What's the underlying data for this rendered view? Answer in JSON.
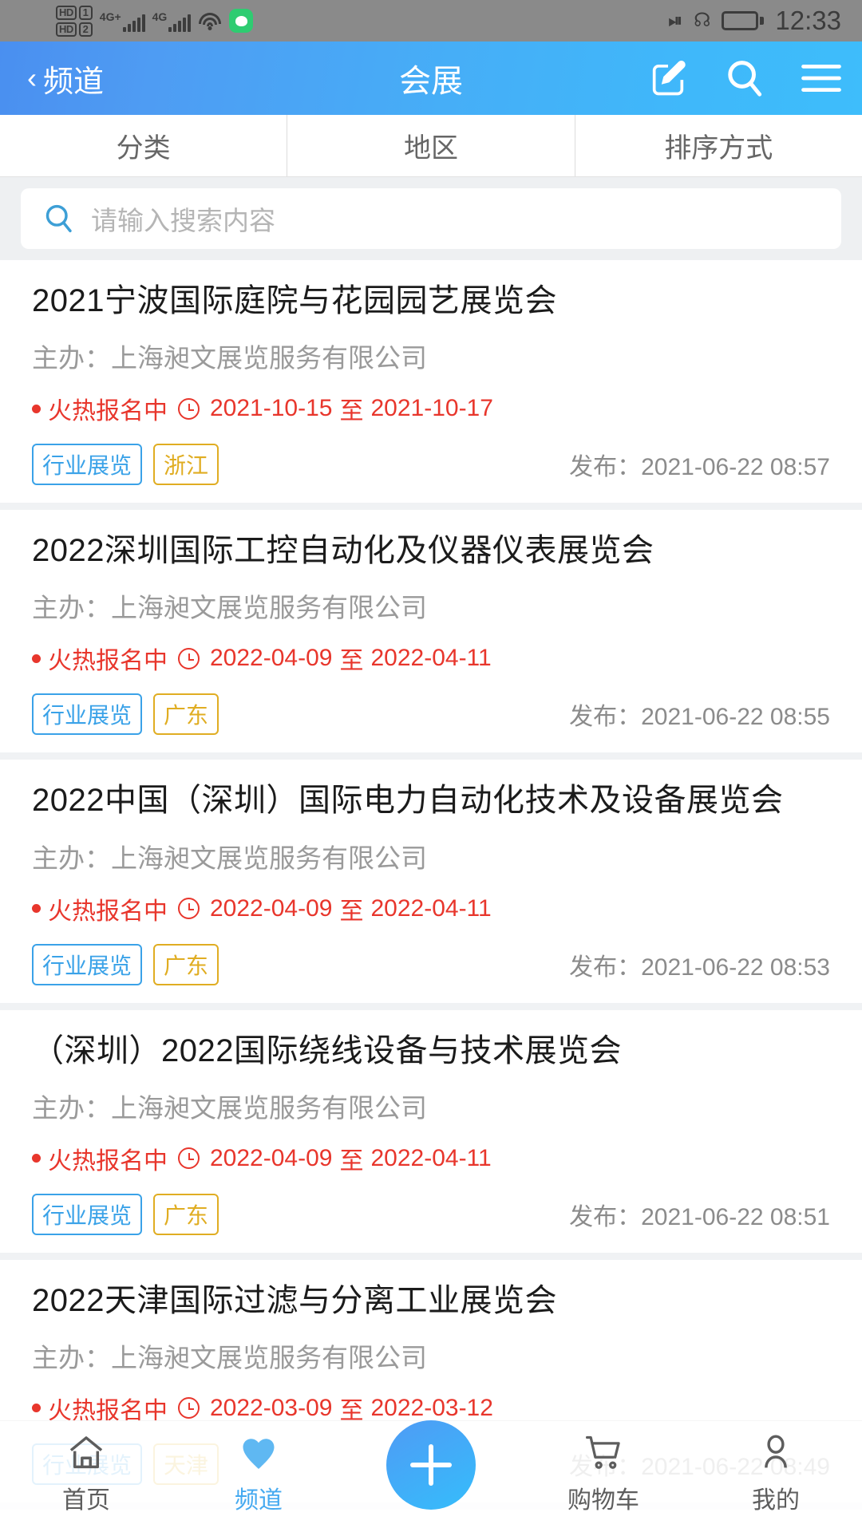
{
  "status_bar": {
    "hd1_label": "HD",
    "hd1_num": "1",
    "hd2_label": "HD",
    "hd2_num": "2",
    "net1": "4G+",
    "net2": "4G",
    "wifi_icon": "wifi-icon",
    "wechat_icon": "wechat-icon",
    "nfc_icon": "nfc-icon",
    "bluetooth_icon": "bluetooth-icon",
    "battery_icon": "battery-icon",
    "time": "12:33"
  },
  "header": {
    "back_label": "频道",
    "back_icon": "chevron-left-icon",
    "title": "会展",
    "compose_icon": "compose-icon",
    "search_icon": "search-icon",
    "menu_icon": "hamburger-menu-icon",
    "accent_color": "#46aef7"
  },
  "filters": [
    {
      "label": "分类"
    },
    {
      "label": "地区"
    },
    {
      "label": "排序方式"
    }
  ],
  "search": {
    "placeholder": "请输入搜索内容",
    "icon": "search-icon"
  },
  "list_labels": {
    "organizer_prefix": "主办：",
    "status_text": "火热报名中",
    "date_sep": "至",
    "publish_prefix": "发布：",
    "clock_icon": "clock-icon"
  },
  "items": [
    {
      "title": "2021宁波国际庭院与花园园艺展览会",
      "organizer": "上海昶文展览服务有限公司",
      "status": "火热报名中",
      "start_date": "2021-10-15",
      "end_date": "2021-10-17",
      "category_tag": "行业展览",
      "region_tag": "浙江",
      "publish_time": "2021-06-22 08:57"
    },
    {
      "title": "2022深圳国际工控自动化及仪器仪表展览会",
      "organizer": "上海昶文展览服务有限公司",
      "status": "火热报名中",
      "start_date": "2022-04-09",
      "end_date": "2022-04-11",
      "category_tag": "行业展览",
      "region_tag": "广东",
      "publish_time": "2021-06-22 08:55"
    },
    {
      "title": "2022中国（深圳）国际电力自动化技术及设备展览会",
      "organizer": "上海昶文展览服务有限公司",
      "status": "火热报名中",
      "start_date": "2022-04-09",
      "end_date": "2022-04-11",
      "category_tag": "行业展览",
      "region_tag": "广东",
      "publish_time": "2021-06-22 08:53"
    },
    {
      "title": "（深圳）2022国际绕线设备与技术展览会",
      "organizer": "上海昶文展览服务有限公司",
      "status": "火热报名中",
      "start_date": "2022-04-09",
      "end_date": "2022-04-11",
      "category_tag": "行业展览",
      "region_tag": "广东",
      "publish_time": "2021-06-22 08:51"
    },
    {
      "title": "2022天津国际过滤与分离工业展览会",
      "organizer": "上海昶文展览服务有限公司",
      "status": "火热报名中",
      "start_date": "2022-03-09",
      "end_date": "2022-03-12",
      "category_tag": "行业展览",
      "region_tag": "天津",
      "publish_time": "2021-06-22 08:49"
    }
  ],
  "tabbar": {
    "items": [
      {
        "label": "首页",
        "icon": "home-icon",
        "active": false
      },
      {
        "label": "频道",
        "icon": "heart-icon",
        "active": true
      },
      {
        "label": "购物车",
        "icon": "shopping-cart-icon",
        "active": false
      },
      {
        "label": "我的",
        "icon": "person-icon",
        "active": false
      }
    ],
    "fab_icon": "plus-icon",
    "active_color": "#44a9f0"
  }
}
